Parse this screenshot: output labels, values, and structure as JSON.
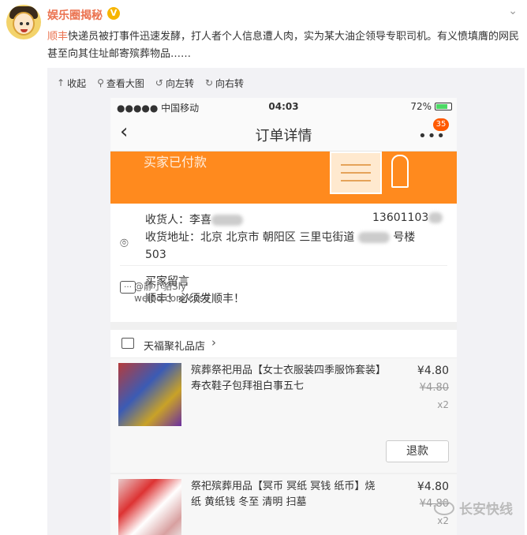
{
  "post": {
    "username": "娱乐圈揭秘",
    "verified_badge": "V",
    "highlight": "顺丰",
    "text_rest": "快递员被打事件迅速发酵，打人者个人信息遭人肉，实为某大油企领导专职司机。有义愤填膺的网民甚至向其住址邮寄殡葬物品……"
  },
  "toolbar": {
    "collapse": "收起",
    "view_large": "查看大图",
    "rotate_left": "向左转",
    "rotate_right": "向右转"
  },
  "phone": {
    "carrier": "●●●●● 中国移动",
    "time": "04:03",
    "battery": "72%",
    "nav_title": "订单详情",
    "badge_count": "35",
    "banner_text": "买家已付款",
    "receiver_label": "收货人：",
    "receiver_name": "李喜",
    "receiver_phone": "13601103",
    "address_label": "收货地址：",
    "address_text": "北京 北京市 朝阳区 三里屯街道",
    "address_tail": "号楼",
    "address_room": "503",
    "message_label": "买家留言",
    "message_text": "顺丰！必须发顺丰！",
    "store_name": "天福聚礼品店",
    "items": [
      {
        "title": "殡葬祭祀用品【女士衣服装四季服饰套装】寿衣鞋子包拜祖白事五七",
        "price": "¥4.80",
        "original_price": "¥4.80",
        "quantity": "x2",
        "refund": "退款"
      },
      {
        "title": "祭祀殡葬用品【冥币 冥纸 冥钱 纸币】烧纸 黄纸钱 冬至 清明 扫墓",
        "price": "¥4.80",
        "original_price": "¥4.80",
        "quantity": "x2"
      }
    ],
    "watermark_line1": "@静小骆Sly",
    "watermark_line2": "weibo.com/cxs7"
  },
  "corner_watermark": "长安快线"
}
